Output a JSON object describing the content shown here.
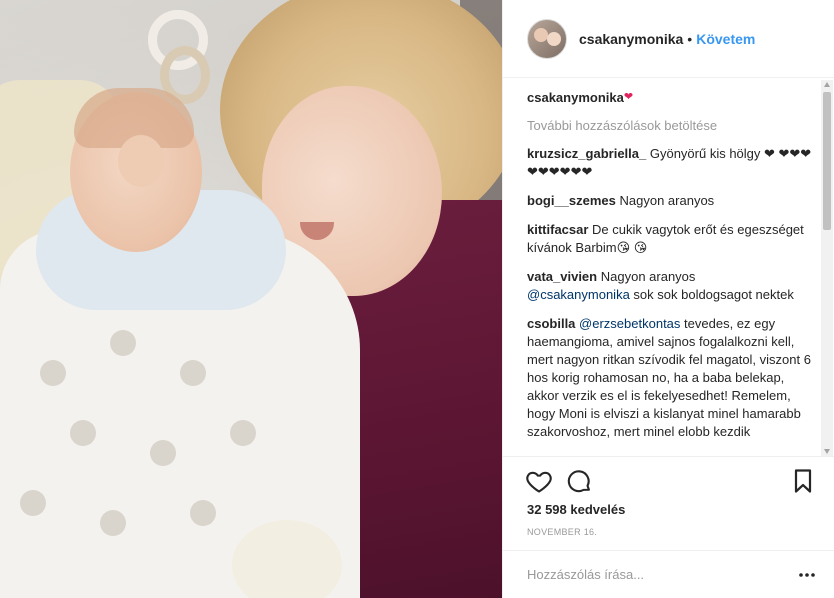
{
  "header": {
    "username": "csakanymonika",
    "separator": "•",
    "follow_label": "Követem"
  },
  "caption": {
    "username": "csakanymonika",
    "heart": "❤"
  },
  "load_more_label": "További hozzászólások betöltése",
  "comments": [
    {
      "user": "kruzsicz_gabriella_",
      "text": "Gyönyörű kis hölgy ❤ ❤❤❤❤❤❤❤❤❤"
    },
    {
      "user": "bogi__szemes",
      "text": "Nagyon aranyos"
    },
    {
      "user": "kittifacsar",
      "text": "De cukik vagytok erőt és egeszséget kívánok Barbim😘 😘"
    },
    {
      "user": "vata_vivien",
      "text_before": "Nagyon aranyos",
      "mention": "@csakanymonika",
      "text_after": "sok sok boldogsagot nektek"
    },
    {
      "user": "csobilla",
      "mention": "@erzsebetkontas",
      "text": "tevedes, ez egy haemangioma, amivel sajnos fogalalkozni kell, mert nagyon ritkan szívodik fel magatol, viszont 6 hos korig rohamosan no, ha a baba belekap, akkor verzik es el is fekelyesedhet! Remelem, hogy Moni is elviszi a kislanyat minel hamarabb szakorvoshoz, mert minel elobb kezdik"
    }
  ],
  "actions": {
    "like_icon": "heart-outline-icon",
    "comment_icon": "comment-bubble-icon",
    "save_icon": "bookmark-icon"
  },
  "likes_label": "32 598 kedvelés",
  "date_label": "NOVEMBER 16.",
  "add_comment": {
    "placeholder": "Hozzászólás írása...",
    "more_icon": "more-options-icon"
  },
  "colors": {
    "link_blue": "#3897f0",
    "mention_blue": "#003569",
    "muted_gray": "#999999",
    "text": "#262626",
    "sweater_plum": "#5a1532"
  }
}
